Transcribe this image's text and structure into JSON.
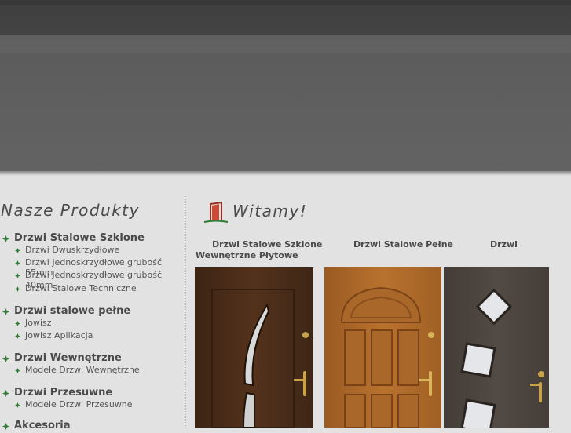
{
  "sidebar": {
    "title": "Nasze Produkty",
    "categories": [
      {
        "label": "Drzwi Stalowe Szklone",
        "items": [
          "Drzwi Dwuskrzydłowe",
          "Drzwi Jednoskrzydłowe grubość 55mm",
          "Drzwi Jednoskrzydłowe grubość 40mm",
          "Drzwi Stalowe Techniczne"
        ]
      },
      {
        "label": "Drzwi stalowe pełne",
        "items": [
          "Jowisz",
          "Jowisz Aplikacja"
        ]
      },
      {
        "label": "Drzwi Wewnętrzne",
        "items": [
          "Modele Drzwi Wewnętrzne"
        ]
      },
      {
        "label": "Drzwi Przesuwne",
        "items": [
          "Modele Drzwi Przesuwne"
        ]
      },
      {
        "label": "Akcesoria",
        "items": []
      }
    ]
  },
  "main": {
    "title": "Witamy!",
    "products": [
      {
        "label": "Drzwi Stalowe Szklone"
      },
      {
        "label": "Drzwi Stalowe Pełne"
      },
      {
        "label": "Drzwi"
      },
      {
        "label": "Wewnętrzne Płytowe"
      }
    ]
  },
  "colors": {
    "bullet_green": "#2e7d32",
    "text": "#4a4a4a",
    "door_dark_walnut": "#4a2c1a",
    "door_golden_oak": "#b06a2a",
    "door_dark_grey": "#4b4540"
  }
}
